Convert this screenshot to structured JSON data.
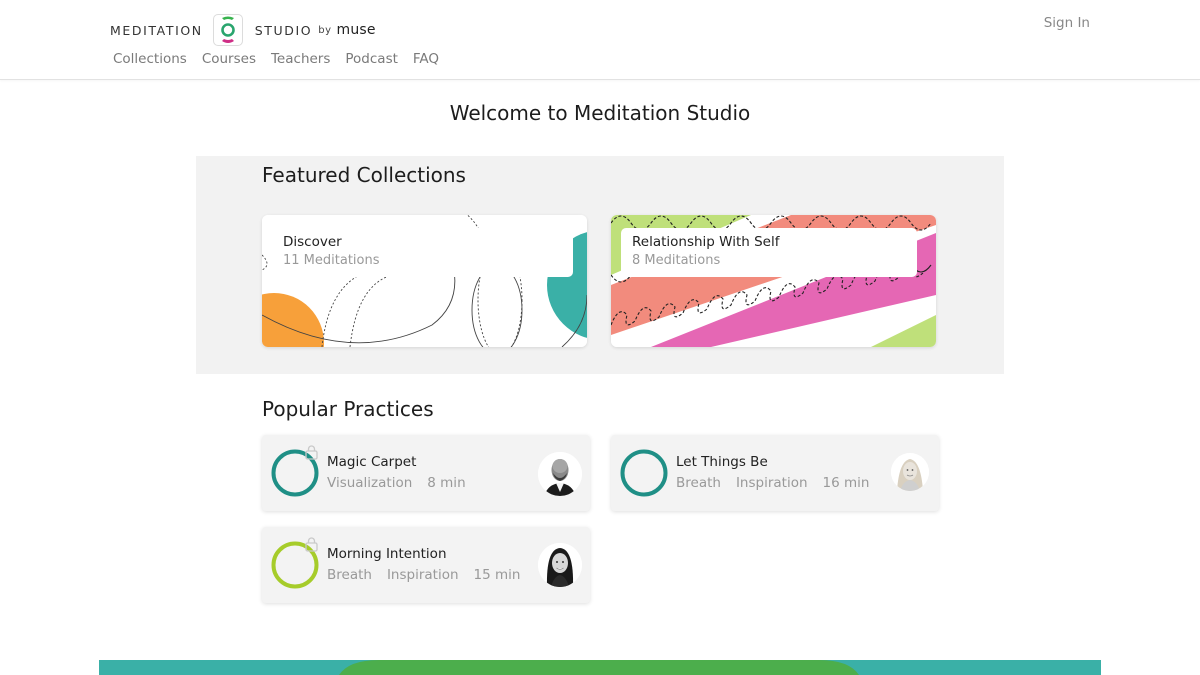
{
  "header": {
    "brand": {
      "word_left": "MEDITATION",
      "word_right": "STUDIO",
      "by": "by",
      "muse": "muse",
      "logo_colors": {
        "top": "#37b24d",
        "ring": "#2aa56e",
        "bottom": "#cf2e86"
      }
    },
    "nav": [
      "Collections",
      "Courses",
      "Teachers",
      "Podcast",
      "FAQ"
    ],
    "sign_in": "Sign In"
  },
  "welcome": "Welcome to Meditation Studio",
  "featured": {
    "title": "Featured Collections",
    "collections": [
      {
        "title": "Discover",
        "count": "11 Meditations",
        "art": "discover"
      },
      {
        "title": "Relationship With Self",
        "count": "8 Meditations",
        "art": "stripes"
      }
    ]
  },
  "popular": {
    "title": "Popular Practices",
    "practices": [
      {
        "title": "Magic Carpet",
        "tags": [
          "Visualization",
          "8 min"
        ],
        "ring_color": "#1f8f86",
        "locked": true,
        "avatar": "man-bald-icon"
      },
      {
        "title": "Let Things Be",
        "tags": [
          "Breath",
          "Inspiration",
          "16 min"
        ],
        "ring_color": "#1f8f86",
        "locked": false,
        "avatar": "woman-blonde-icon"
      },
      {
        "title": "Morning Intention",
        "tags": [
          "Breath",
          "Inspiration",
          "15 min"
        ],
        "ring_color": "#a6cc2a",
        "locked": true,
        "avatar": "woman-dark-hair-icon"
      }
    ]
  },
  "colors": {
    "teal": "#3ab0a7",
    "green": "#4cae4c",
    "orange": "#f7a03a",
    "salmon": "#f28b7d",
    "pink": "#e567b4",
    "lime": "#bfe07a"
  }
}
